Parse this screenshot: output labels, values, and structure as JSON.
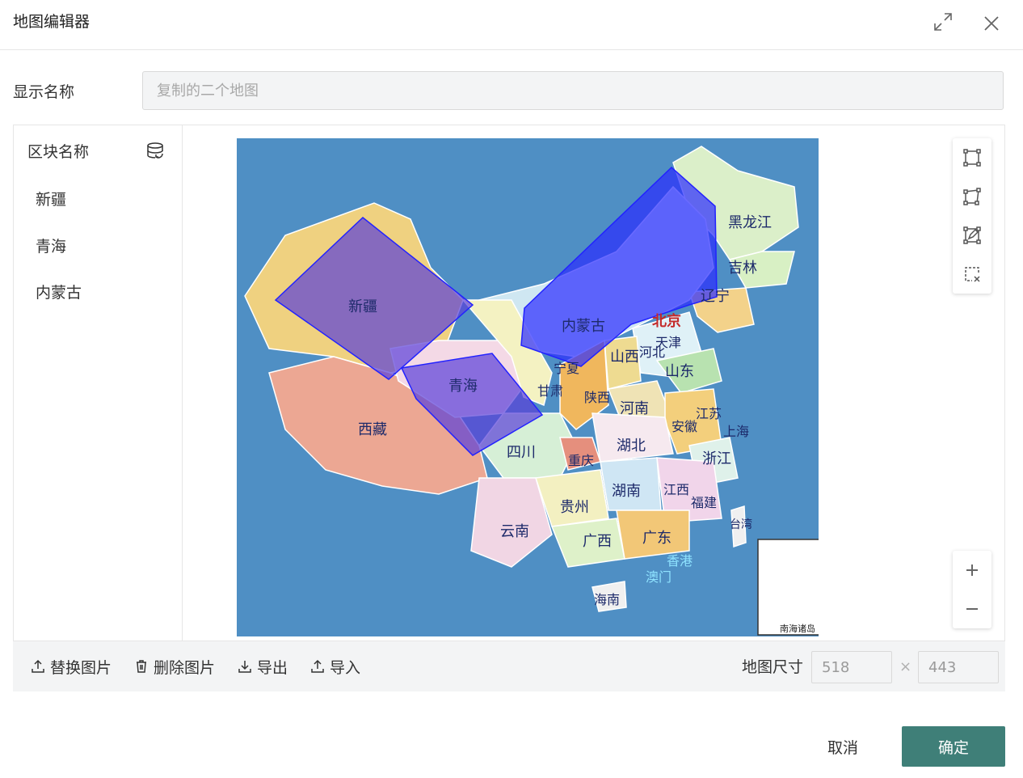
{
  "dialog": {
    "title": "地图编辑器"
  },
  "name_row": {
    "label": "显示名称",
    "placeholder": "复制的二个地图"
  },
  "block_list": {
    "title": "区块名称",
    "items": [
      {
        "label": "新疆"
      },
      {
        "label": "青海"
      },
      {
        "label": "内蒙古"
      }
    ]
  },
  "map": {
    "provinces": [
      "黑龙江",
      "吉林",
      "辽宁",
      "北京",
      "天津",
      "河北",
      "山西",
      "山东",
      "内蒙古",
      "新疆",
      "青海",
      "西藏",
      "甘肃",
      "宁夏",
      "陕西",
      "河南",
      "江苏",
      "安徽",
      "上海",
      "湖北",
      "四川",
      "重庆",
      "浙江",
      "湖南",
      "江西",
      "福建",
      "贵州",
      "云南",
      "广西",
      "广东",
      "台湾",
      "香港",
      "澳门",
      "海南"
    ],
    "inset_label": "南海诸岛",
    "regions": [
      {
        "name": "新疆",
        "color": "#5a3fd8"
      },
      {
        "name": "青海",
        "color": "#5a3fd8"
      },
      {
        "name": "内蒙古",
        "color": "#2b2bff"
      }
    ]
  },
  "tools": [
    "rectangle-tool-icon",
    "polygon-tool-icon",
    "edit-shape-icon",
    "clear-selection-icon"
  ],
  "toolbar": {
    "replace_label": "替换图片",
    "delete_label": "删除图片",
    "export_label": "导出",
    "import_label": "导入",
    "size_label": "地图尺寸",
    "width": "518",
    "height": "443",
    "times": "×"
  },
  "footer": {
    "cancel_label": "取消",
    "ok_label": "确定"
  },
  "colors": {
    "accent": "#3f7f78",
    "sea": "#4f8fc4"
  }
}
